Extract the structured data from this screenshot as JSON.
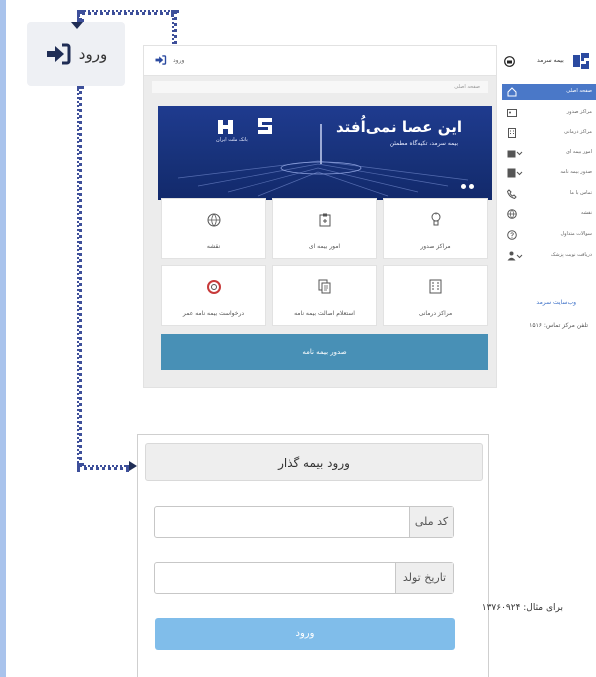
{
  "callout": {
    "label": "ورود",
    "icon": "login-arrow-icon"
  },
  "topbar": {
    "enter_label": "ورود",
    "icon": "login-arrow-icon"
  },
  "breadcrumb": "صفحه اصلی",
  "banner": {
    "title": "این عصا نمی‌اُفتد",
    "subtitle": "بیمه سرمد، تکیه‌گاه مطمئن",
    "tagline": "بانک ملت ایران"
  },
  "tiles": [
    {
      "label": "نقشه",
      "icon": "globe-icon"
    },
    {
      "label": "امور بیمه ای",
      "icon": "clipboard-icon"
    },
    {
      "label": "مراکز صدور",
      "icon": "lightbulb-icon"
    },
    {
      "label": "درخواست بیمه نامه عمر",
      "icon": "lifebuoy-icon"
    },
    {
      "label": "استعلام اصالت بیمه نامه",
      "icon": "documents-icon"
    },
    {
      "label": "مراکز درمانی",
      "icon": "building-icon"
    }
  ],
  "issue_button": "صدور بیمه نامه",
  "sidebar": {
    "brand": "بیمه سرمد",
    "items": [
      {
        "label": "صفحه اصلی",
        "icon": "home-icon"
      },
      {
        "label": "مراکز صدور",
        "icon": "id-card-icon"
      },
      {
        "label": "مراکز درمانی",
        "icon": "building-icon"
      },
      {
        "label": "امور بیمه ای",
        "icon": "briefcase-icon"
      },
      {
        "label": "صدور بیمه نامه",
        "icon": "document-icon"
      },
      {
        "label": "تماس با ما",
        "icon": "phone-icon"
      },
      {
        "label": "نقشه",
        "icon": "globe-icon"
      },
      {
        "label": "سوالات متداول",
        "icon": "question-icon"
      },
      {
        "label": "دریافت نوبت پزشک",
        "icon": "doctor-icon"
      }
    ],
    "site_link": "وب‌سایت سرمد",
    "phone": "تلفن مرکز تماس: ۱۵۱۶"
  },
  "form": {
    "title": "ورود بیمه گذار",
    "national_code_label": "کد ملی",
    "national_code_value": "",
    "birth_date_label": "تاریخ تولد",
    "birth_date_value": "",
    "hint": "برای مثال: ۱۳۷۶۰۹۲۴",
    "submit": "ورود"
  }
}
